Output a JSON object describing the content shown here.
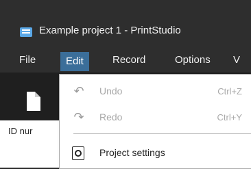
{
  "window": {
    "title": "Example project 1 - PrintStudio"
  },
  "menubar": {
    "items": [
      {
        "label": "File"
      },
      {
        "label": "Edit"
      },
      {
        "label": "Record"
      },
      {
        "label": "Options"
      },
      {
        "label": "V"
      }
    ]
  },
  "grid": {
    "column_header": "ID nur"
  },
  "edit_menu": {
    "items": [
      {
        "label": "Undo",
        "shortcut": "Ctrl+Z",
        "icon": "undo-icon"
      },
      {
        "label": "Redo",
        "shortcut": "Ctrl+Y",
        "icon": "redo-icon"
      },
      {
        "label": "Project settings",
        "icon": "project-settings-icon"
      }
    ]
  },
  "colors": {
    "menu_active_bg": "#3b6e99",
    "dark_chrome": "#2e2e2e",
    "disabled_text": "#a9a9a9"
  }
}
